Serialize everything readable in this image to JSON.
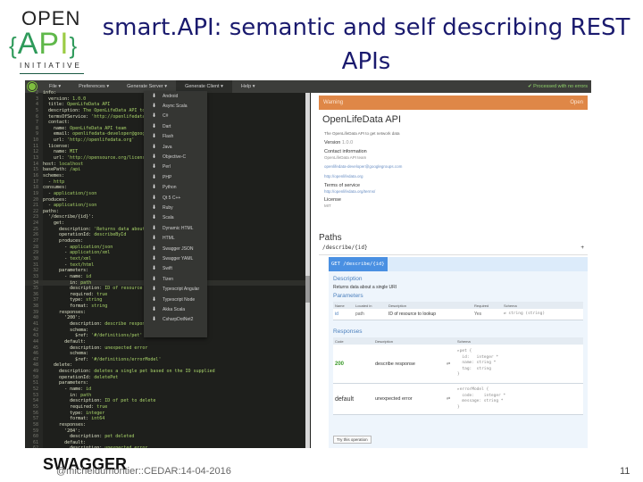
{
  "slide": {
    "title": "smart.API: semantic and self describing REST APIs",
    "logo": {
      "open": "OPEN",
      "api_left": "{",
      "api_a": "A",
      "api_p": "P",
      "api_i": "I",
      "api_right": "}",
      "initiative": "INITIATIVE"
    },
    "swagger_label": "SWAGGER",
    "footer": "@micheldumontier::CEDAR:14-04-2016",
    "page_number": "11"
  },
  "editor": {
    "menu": [
      "File ▾",
      "Preferences ▾",
      "Generate Server ▾",
      "Generate Client ▾",
      "Help ▾"
    ],
    "status": "✔ Processed with no errors",
    "client_menu": [
      "Android",
      "Async Scala",
      "C#",
      "Dart",
      "Flash",
      "Java",
      "Objective-C",
      "Perl",
      "PHP",
      "Python",
      "Qt 5 C++",
      "Ruby",
      "Scala",
      "Dynamic HTML",
      "HTML",
      "Swagger JSON",
      "Swagger YAML",
      "Swift",
      "Tizen",
      "Typescript Angular",
      "Typescript Node",
      "Akka Scala",
      "CsharpDotNet2"
    ],
    "code": [
      {
        "n": "2",
        "k": "info:",
        "v": ""
      },
      {
        "n": "3",
        "k": "  version: ",
        "v": "1.0.0"
      },
      {
        "n": "4",
        "k": "  title: ",
        "v": "OpenLifeData API"
      },
      {
        "n": "5",
        "k": "  description: ",
        "v": "The OpenLifeData API to get network data"
      },
      {
        "n": "6",
        "k": "  termsOfService: ",
        "v": "'http://openlifedata.org/terms/'"
      },
      {
        "n": "7",
        "k": "  contact:",
        "v": ""
      },
      {
        "n": "8",
        "k": "    name: ",
        "v": "OpenLifeData API team"
      },
      {
        "n": "9",
        "k": "    email: ",
        "v": "openlifedata-developer@googlegroups.com"
      },
      {
        "n": "10",
        "k": "    url: ",
        "v": "'http://openlifedata.org'"
      },
      {
        "n": "11",
        "k": "  license:",
        "v": ""
      },
      {
        "n": "12",
        "k": "    name: ",
        "v": "MIT"
      },
      {
        "n": "13",
        "k": "    url: ",
        "v": "'http://opensource.org/licenses/MIT'"
      },
      {
        "n": "14",
        "k": "host: ",
        "v": "localhost"
      },
      {
        "n": "15",
        "k": "basePath: ",
        "v": "/api"
      },
      {
        "n": "16",
        "k": "schemes:",
        "v": ""
      },
      {
        "n": "17",
        "k": "  - ",
        "v": "http"
      },
      {
        "n": "18",
        "k": "consumes:",
        "v": ""
      },
      {
        "n": "19",
        "k": "  - ",
        "v": "application/json"
      },
      {
        "n": "20",
        "k": "produces:",
        "v": ""
      },
      {
        "n": "21",
        "k": "  - ",
        "v": "application/json"
      },
      {
        "n": "22",
        "k": "paths:",
        "v": ""
      },
      {
        "n": "23",
        "k": "  '/describe/{id}':",
        "v": ""
      },
      {
        "n": "24",
        "k": "    get:",
        "v": ""
      },
      {
        "n": "25",
        "k": "      description: ",
        "v": "'Returns data about a single URI'"
      },
      {
        "n": "26",
        "k": "      operationId: ",
        "v": "describeById"
      },
      {
        "n": "27",
        "k": "      produces:",
        "v": ""
      },
      {
        "n": "28",
        "k": "        - ",
        "v": "application/json"
      },
      {
        "n": "29",
        "k": "        - ",
        "v": "application/xml"
      },
      {
        "n": "30",
        "k": "        - ",
        "v": "text/xml"
      },
      {
        "n": "31",
        "k": "        - ",
        "v": "text/html"
      },
      {
        "n": "32",
        "k": "      parameters:",
        "v": ""
      },
      {
        "n": "33",
        "k": "        - name: ",
        "v": "id"
      },
      {
        "n": "34",
        "k": "          in: ",
        "v": "path"
      },
      {
        "n": "35",
        "k": "          description: ",
        "v": "ID of resource to lookup"
      },
      {
        "n": "36",
        "k": "          required: ",
        "v": "true"
      },
      {
        "n": "37",
        "k": "          type: ",
        "v": "string"
      },
      {
        "n": "38",
        "k": "          format: ",
        "v": "string"
      },
      {
        "n": "39",
        "k": "      responses:",
        "v": ""
      },
      {
        "n": "40",
        "k": "        '200':",
        "v": ""
      },
      {
        "n": "41",
        "k": "          description: ",
        "v": "describe response"
      },
      {
        "n": "42",
        "k": "          schema:",
        "v": ""
      },
      {
        "n": "43",
        "k": "            $ref: ",
        "v": "'#/definitions/pet'"
      },
      {
        "n": "44",
        "k": "        default:",
        "v": ""
      },
      {
        "n": "45",
        "k": "          description: ",
        "v": "unexpected error"
      },
      {
        "n": "46",
        "k": "          schema:",
        "v": ""
      },
      {
        "n": "47",
        "k": "            $ref: ",
        "v": "'#/definitions/errorModel'"
      },
      {
        "n": "48",
        "k": "    delete:",
        "v": ""
      },
      {
        "n": "49",
        "k": "      description: ",
        "v": "deletes a single pet based on the ID supplied"
      },
      {
        "n": "50",
        "k": "      operationId: ",
        "v": "deletePet"
      },
      {
        "n": "51",
        "k": "      parameters:",
        "v": ""
      },
      {
        "n": "52",
        "k": "        - name: ",
        "v": "id"
      },
      {
        "n": "53",
        "k": "          in: ",
        "v": "path"
      },
      {
        "n": "54",
        "k": "          description: ",
        "v": "ID of pet to delete"
      },
      {
        "n": "55",
        "k": "          required: ",
        "v": "true"
      },
      {
        "n": "56",
        "k": "          type: ",
        "v": "integer"
      },
      {
        "n": "57",
        "k": "          format: ",
        "v": "int64"
      },
      {
        "n": "58",
        "k": "      responses:",
        "v": ""
      },
      {
        "n": "59",
        "k": "        '204':",
        "v": ""
      },
      {
        "n": "60",
        "k": "          description: ",
        "v": "pet deleted"
      },
      {
        "n": "61",
        "k": "        default:",
        "v": ""
      },
      {
        "n": "62",
        "k": "          description: ",
        "v": "unexpected error"
      }
    ]
  },
  "preview": {
    "warning": "Warning",
    "warning_action": "Open",
    "api_title": "OpenLifeData API",
    "api_description": "The OpenLifeData API to get network data",
    "version_label": "Version",
    "version": "1.0.0",
    "contact_label": "Contact information",
    "contact_name": "OpenLifeData API team",
    "contact_email": "openlifedata-developer@googlegroups.com",
    "contact_url": "http://openlifedata.org",
    "tos_label": "Terms of service",
    "tos_url": "http://openlifedata.org/terms/",
    "license_label": "License",
    "license": "MIT",
    "paths_label": "Paths",
    "path": "/describe/{id}",
    "path_toggle": "+",
    "operation": "GET /describe/{id}",
    "description_label": "Description",
    "description": "Returns data about a single URI",
    "parameters_label": "Parameters",
    "param_headers": [
      "Name",
      "Located in",
      "Description",
      "Required",
      "Schema"
    ],
    "param": {
      "name": "id",
      "in": "path",
      "description": "ID of resource to lookup",
      "required": "Yes",
      "schema": "⇄ string (string)"
    },
    "responses_label": "Responses",
    "resp_headers": [
      "Code",
      "Description",
      "Schema"
    ],
    "responses": [
      {
        "code": "200",
        "description": "describe response",
        "icon": "⇄",
        "schema": [
          "▸pet {",
          "  id:   integer *",
          "  name: string *",
          "  tag:  string",
          "}"
        ]
      },
      {
        "code": "default",
        "description": "unexpected error",
        "icon": "⇄",
        "schema": [
          "▸errorModel {",
          "  code:    integer *",
          "  message: string *",
          "}"
        ]
      }
    ],
    "try_button": "Try this operation"
  }
}
